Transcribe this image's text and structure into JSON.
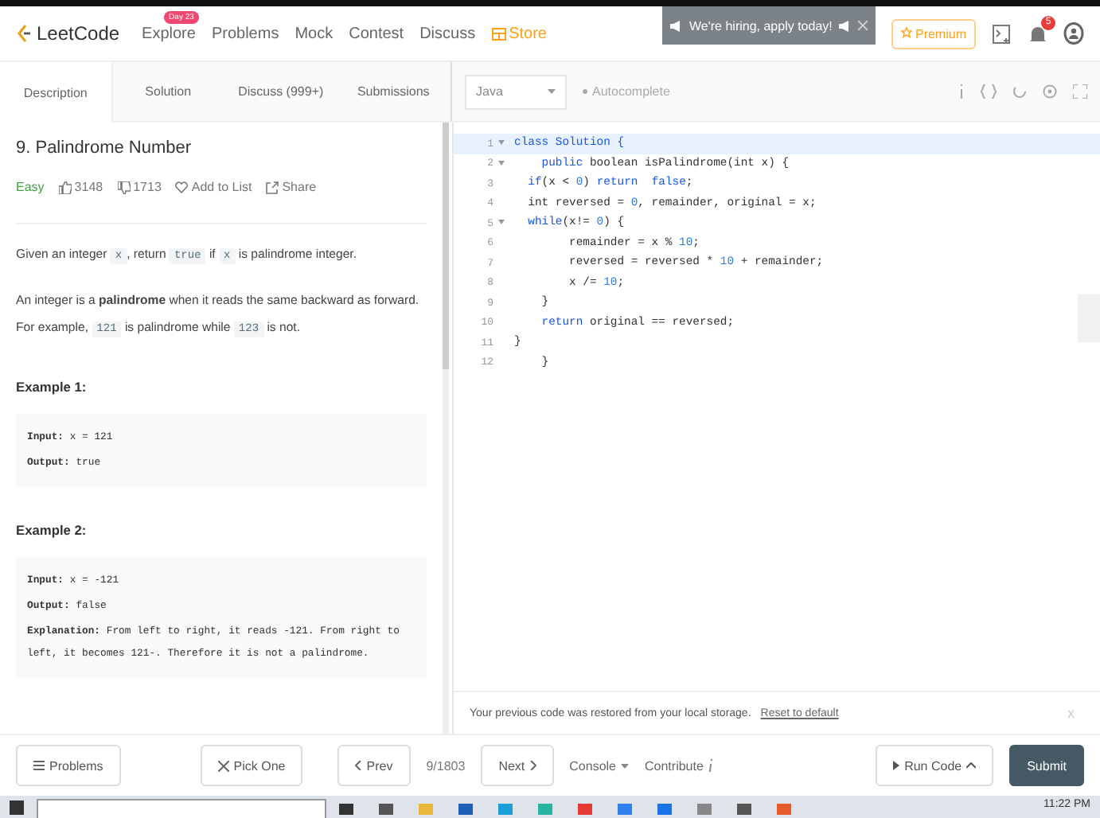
{
  "nav": {
    "logo": "LeetCode",
    "links": [
      {
        "label": "Explore",
        "badge": "Day 23",
        "kind": "plain"
      },
      {
        "label": "Problems",
        "kind": "plain"
      },
      {
        "label": "Mock",
        "kind": "plain"
      },
      {
        "label": "Contest",
        "kind": "plain"
      },
      {
        "label": "Discuss",
        "kind": "plain"
      },
      {
        "label": "Store",
        "kind": "store"
      }
    ],
    "banner": "We're hiring, apply today!",
    "premium": "Premium",
    "notifications": "5"
  },
  "tabs": [
    {
      "label": "Description",
      "selected": true
    },
    {
      "label": "Solution",
      "selected": false
    },
    {
      "label": "Discuss (999+)",
      "selected": false
    },
    {
      "label": "Submissions",
      "selected": false
    }
  ],
  "editor_toolbar": {
    "language": "Java",
    "autocomplete": "Autocomplete"
  },
  "problem": {
    "title": "9. Palindrome Number",
    "difficulty": "Easy",
    "likes": "3148",
    "dislikes": "1713",
    "add_to_list": "Add to List",
    "share": "Share",
    "paragraphs": [
      [
        {
          "kind": "text",
          "text": "Given an integer "
        },
        {
          "kind": "code",
          "text": "x"
        },
        {
          "kind": "text",
          "text": ", return "
        },
        {
          "kind": "code",
          "text": "true"
        },
        {
          "kind": "text",
          "text": " if "
        },
        {
          "kind": "code",
          "text": "x"
        },
        {
          "kind": "text",
          "text": " is palindrome integer."
        }
      ],
      [
        {
          "kind": "text",
          "text": "An integer is a **palindrome** when it reads the same backward as forward. For example, "
        },
        {
          "kind": "code",
          "text": "121"
        },
        {
          "kind": "text",
          "text": " is palindrome while "
        },
        {
          "kind": "code",
          "text": "123"
        },
        {
          "kind": "text",
          "text": " is not."
        }
      ]
    ],
    "examples": [
      {
        "title": "Example 1:",
        "lines": [
          "**Input:** x = 121",
          "**Output:** true"
        ]
      },
      {
        "title": "Example 2:",
        "lines": [
          "**Input:** x = -121",
          "**Output:** false",
          "**Explanation:** From left to right, it reads -121. From right to left, it becomes 121-. Therefore it is not a palindrome."
        ]
      }
    ]
  },
  "code": [
    {
      "number": "1",
      "foldable": true,
      "active": true,
      "tokens": [
        {
          "kind": "kw",
          "text": "class Solution {"
        }
      ]
    },
    {
      "number": "2",
      "foldable": true,
      "active": false,
      "tokens": [
        {
          "kind": "kw",
          "text": "    public"
        },
        {
          "kind": "plain",
          "text": " boolean isPalindrome(int x) {"
        }
      ]
    },
    {
      "number": "3",
      "foldable": false,
      "active": false,
      "tokens": [
        {
          "kind": "kw",
          "text": "  if"
        },
        {
          "kind": "plain",
          "text": "(x < "
        },
        {
          "kind": "num",
          "text": "0"
        },
        {
          "kind": "plain",
          "text": ") "
        },
        {
          "kind": "kw",
          "text": "return  false"
        },
        {
          "kind": "plain",
          "text": ";"
        }
      ]
    },
    {
      "number": "4",
      "foldable": false,
      "active": false,
      "tokens": [
        {
          "kind": "plain",
          "text": "  int reversed = "
        },
        {
          "kind": "num",
          "text": "0"
        },
        {
          "kind": "plain",
          "text": ", remainder, original = x;"
        }
      ]
    },
    {
      "number": "5",
      "foldable": true,
      "active": false,
      "tokens": [
        {
          "kind": "kw",
          "text": "  while"
        },
        {
          "kind": "plain",
          "text": "(x!= "
        },
        {
          "kind": "num",
          "text": "0"
        },
        {
          "kind": "plain",
          "text": ") {"
        }
      ]
    },
    {
      "number": "6",
      "foldable": false,
      "active": false,
      "tokens": [
        {
          "kind": "plain",
          "text": "        remainder = x % "
        },
        {
          "kind": "num",
          "text": "10"
        },
        {
          "kind": "plain",
          "text": ";"
        }
      ]
    },
    {
      "number": "7",
      "foldable": false,
      "active": false,
      "tokens": [
        {
          "kind": "plain",
          "text": "        reversed = reversed * "
        },
        {
          "kind": "num",
          "text": "10"
        },
        {
          "kind": "plain",
          "text": " + remainder;"
        }
      ]
    },
    {
      "number": "8",
      "foldable": false,
      "active": false,
      "tokens": [
        {
          "kind": "plain",
          "text": "        x /= "
        },
        {
          "kind": "num",
          "text": "10"
        },
        {
          "kind": "plain",
          "text": ";"
        }
      ]
    },
    {
      "number": "9",
      "foldable": false,
      "active": false,
      "tokens": [
        {
          "kind": "plain",
          "text": "    }"
        }
      ]
    },
    {
      "number": "10",
      "foldable": false,
      "active": false,
      "tokens": [
        {
          "kind": "kw",
          "text": "    return"
        },
        {
          "kind": "plain",
          "text": " original == reversed;"
        }
      ]
    },
    {
      "number": "11",
      "foldable": false,
      "active": false,
      "tokens": [
        {
          "kind": "plain",
          "text": "}"
        }
      ]
    },
    {
      "number": "12",
      "foldable": false,
      "active": false,
      "tokens": [
        {
          "kind": "plain",
          "text": "    }"
        }
      ]
    }
  ],
  "restore_notice": {
    "text": "Your previous code was restored from your local storage.",
    "link": "Reset to default",
    "close": "x"
  },
  "bottom_bar": {
    "problems": "Problems",
    "pick_one": "Pick One",
    "prev": "Prev",
    "position": "9/1803",
    "next": "Next",
    "console": "Console",
    "contribute": "Contribute",
    "run_code": "Run Code",
    "submit": "Submit"
  },
  "taskbar": {
    "time": "11:22 PM"
  }
}
